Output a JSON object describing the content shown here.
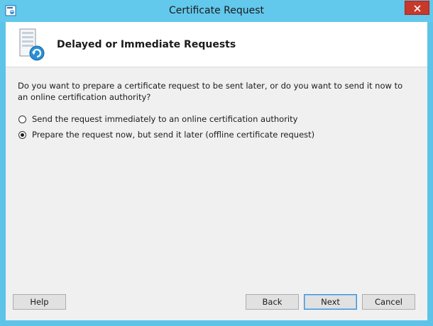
{
  "window": {
    "title": "Certificate Request",
    "icons": {
      "app": "certificate-app-icon",
      "close": "close-icon"
    }
  },
  "header": {
    "title": "Delayed or Immediate Requests",
    "icon": "server-request-icon"
  },
  "body": {
    "question": "Do you want to prepare a certificate request to be sent later, or do you want to send it now to an online certification authority?",
    "options": [
      {
        "label": "Send the request immediately to an online certification authority",
        "selected": false
      },
      {
        "label": "Prepare the request now, but send it later (offline certificate request)",
        "selected": true
      }
    ]
  },
  "buttons": {
    "help": "Help",
    "back": "Back",
    "next": "Next",
    "cancel": "Cancel"
  },
  "colors": {
    "titlebar": "#62c8ec",
    "close_button": "#c8392b",
    "dialog_background": "#f0f0f0",
    "default_button_border": "#3c8fd6"
  }
}
